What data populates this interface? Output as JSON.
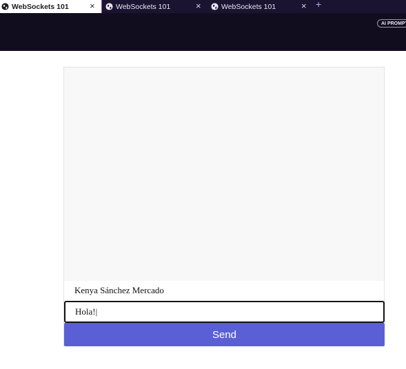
{
  "browser": {
    "tabs": [
      {
        "title": "WebSockets 101",
        "active": true
      },
      {
        "title": "WebSockets 101",
        "active": false
      },
      {
        "title": "WebSockets 101",
        "active": false
      }
    ],
    "close_glyph": "×",
    "new_tab_glyph": "+",
    "ai_prompt_label": "AI PROMPT",
    "tab_icon": "globe-icon"
  },
  "chat": {
    "username": "Kenya Sánchez Mercado",
    "message_value": "Hola!|",
    "send_label": "Send"
  },
  "colors": {
    "accent": "#5a5fd6",
    "chrome_dark": "#120d1e",
    "tab_divider": "#6f4fd4"
  }
}
